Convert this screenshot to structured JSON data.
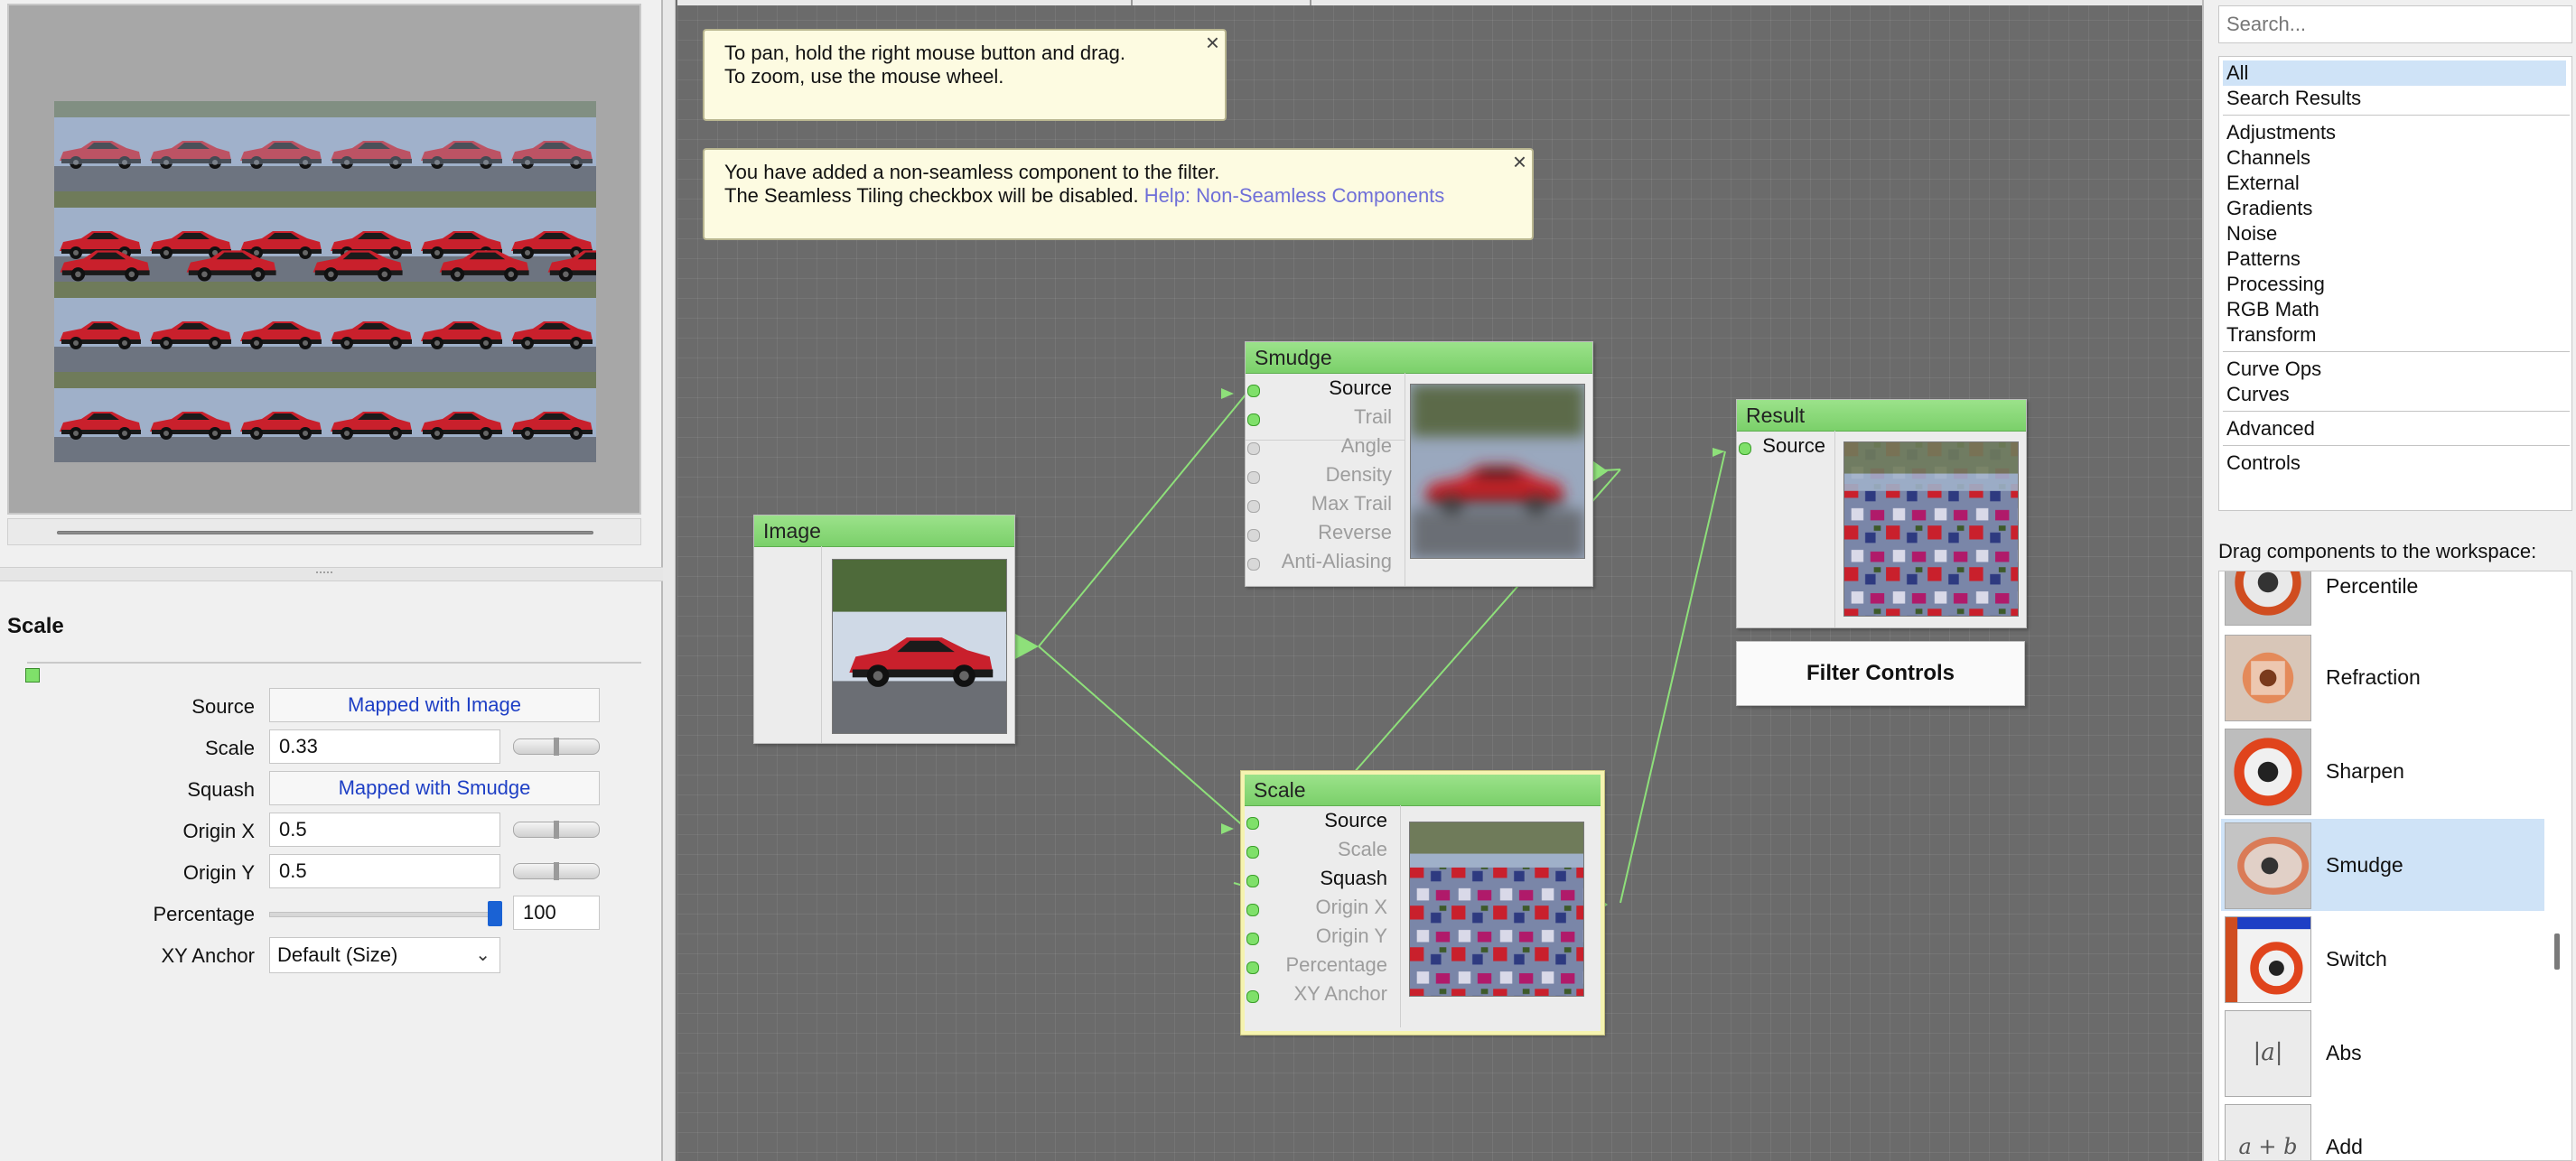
{
  "left_panel": {
    "properties_title": "Scale",
    "properties": [
      {
        "label": "Source",
        "kind": "mapped",
        "value": "Mapped with Image"
      },
      {
        "label": "Scale",
        "kind": "number",
        "value": "0.33"
      },
      {
        "label": "Squash",
        "kind": "mapped",
        "value": "Mapped with Smudge"
      },
      {
        "label": "Origin X",
        "kind": "number",
        "value": "0.5"
      },
      {
        "label": "Origin Y",
        "kind": "number",
        "value": "0.5"
      },
      {
        "label": "Percentage",
        "kind": "slider",
        "value": "100"
      },
      {
        "label": "XY Anchor",
        "kind": "select",
        "value": "Default (Size)"
      }
    ]
  },
  "tips": {
    "pan_line1": "To pan, hold the right mouse button and drag.",
    "pan_line2": "To zoom, use the mouse wheel.",
    "seamless_line1": "You have added a non-seamless component to the filter.",
    "seamless_line2": "The Seamless Tiling checkbox will be disabled.",
    "seamless_link": "Help: Non-Seamless Components",
    "close": "×"
  },
  "nodes": {
    "image": {
      "title": "Image"
    },
    "smudge": {
      "title": "Smudge",
      "ports": [
        {
          "label": "Source",
          "active": true
        },
        {
          "label": "Trail",
          "active": false
        },
        {
          "label": "Angle",
          "active": false
        },
        {
          "label": "Density",
          "active": false
        },
        {
          "label": "Max Trail",
          "active": false
        },
        {
          "label": "Reverse",
          "active": false
        },
        {
          "label": "Anti-Aliasing",
          "active": false
        }
      ]
    },
    "result": {
      "title": "Result",
      "ports": [
        {
          "label": "Source",
          "active": true
        }
      ]
    },
    "scale": {
      "title": "Scale",
      "ports": [
        {
          "label": "Source",
          "active": true
        },
        {
          "label": "Scale",
          "active": false
        },
        {
          "label": "Squash",
          "active": true
        },
        {
          "label": "Origin X",
          "active": false
        },
        {
          "label": "Origin Y",
          "active": false
        },
        {
          "label": "Percentage",
          "active": false
        },
        {
          "label": "XY Anchor",
          "active": false
        }
      ]
    }
  },
  "filter_controls_label": "Filter Controls",
  "right_panel": {
    "search_placeholder": "Search...",
    "categories": [
      "All",
      "Search Results",
      "Adjustments",
      "Channels",
      "External",
      "Gradients",
      "Noise",
      "Patterns",
      "Processing",
      "RGB Math",
      "Transform",
      "Curve Ops",
      "Curves",
      "Advanced",
      "Controls"
    ],
    "selected_category": "All",
    "drag_label": "Drag components to the workspace:",
    "components": [
      {
        "name": "Percentile",
        "icon": "percentile-icon"
      },
      {
        "name": "Refraction",
        "icon": "refraction-icon"
      },
      {
        "name": "Sharpen",
        "icon": "sharpen-icon"
      },
      {
        "name": "Smudge",
        "icon": "smudge-icon"
      },
      {
        "name": "Switch",
        "icon": "switch-icon"
      },
      {
        "name": "Abs",
        "icon": "abs-icon",
        "glyph": "|a|"
      },
      {
        "name": "Add",
        "icon": "add-icon",
        "glyph": "a + b"
      }
    ],
    "selected_component": "Smudge"
  },
  "colors": {
    "node_header": "#8fd97c",
    "tip_bg": "#fdfbe1",
    "link": "#6f6fd8",
    "selection": "#cfe3f7",
    "wire": "#8ee07a"
  }
}
